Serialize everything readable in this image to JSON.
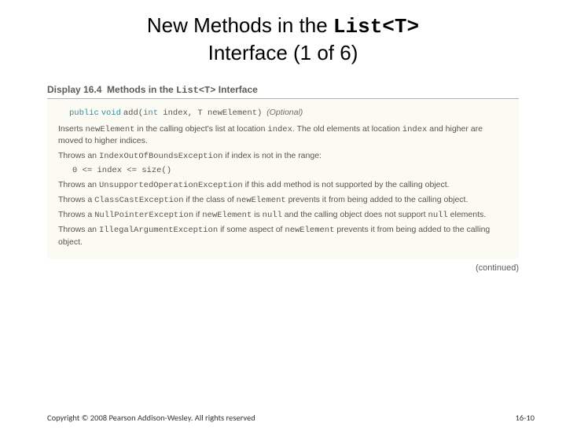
{
  "title": {
    "line1_pre": "New Methods in the ",
    "line1_code": "List<T>",
    "line2": "Interface (1 of 6)"
  },
  "display": {
    "label": "Display 16.4",
    "title_pre": "Methods in the ",
    "title_code": "List<T>",
    "title_post": " Interface"
  },
  "method": {
    "kw_public": "public",
    "kw_void": "void",
    "name": "add",
    "paren_open": "(",
    "kw_int": "int",
    "param1": " index, T newElement",
    "paren_close": ")",
    "optional": "(Optional)",
    "desc1_a": "Inserts ",
    "desc1_code1": "newElement",
    "desc1_b": " in the calling object's list at location ",
    "desc1_code2": "index",
    "desc1_c": ". The old elements at location ",
    "desc1_code3": "index",
    "desc1_d": " and higher are moved to higher indices.",
    "desc2_a": "Throws an ",
    "desc2_code": "IndexOutOfBoundsException",
    "desc2_b": " if index is not in the range:",
    "range": "0 <= index <= size()",
    "desc3_a": "Throws an ",
    "desc3_code": "UnsupportedOperationException",
    "desc3_b": " if this ",
    "desc3_code2": "add",
    "desc3_c": " method is not supported by the calling object.",
    "desc4_a": "Throws a ",
    "desc4_code": "ClassCastException",
    "desc4_b": " if the class of ",
    "desc4_code2": "newElement",
    "desc4_c": " prevents it from being added to the calling object.",
    "desc5_a": "Throws a ",
    "desc5_code": "NullPointerException",
    "desc5_b": " if ",
    "desc5_code2": "newElement",
    "desc5_c": " is ",
    "desc5_code3": "null",
    "desc5_d": " and the calling object does not support ",
    "desc5_code4": "null",
    "desc5_e": " elements.",
    "desc6_a": "Throws an ",
    "desc6_code": "IllegalArgumentException",
    "desc6_b": " if some aspect of ",
    "desc6_code2": "newElement",
    "desc6_c": " prevents it from being added to the calling object."
  },
  "continued": "(continued)",
  "footer": {
    "copyright": "Copyright © 2008 Pearson Addison-Wesley. All rights reserved",
    "page": "16-10"
  }
}
